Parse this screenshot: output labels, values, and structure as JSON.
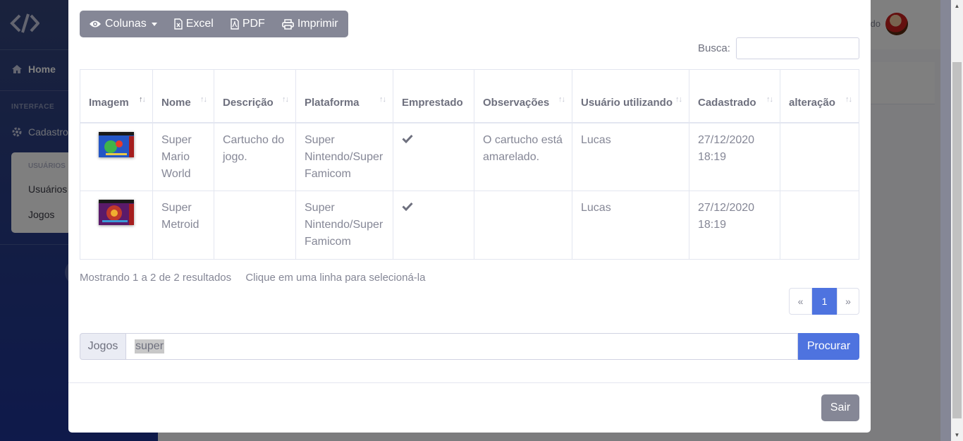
{
  "app": {
    "sidebar": {
      "home_label": "Home",
      "heading": "INTERFACE",
      "cadastros_label": "Cadastros",
      "submenu_heading": "USUÁRIOS",
      "submenu_items": [
        "Usuários",
        "Jogos"
      ]
    },
    "topbar": {
      "user_name": "Eduardo"
    }
  },
  "modal": {
    "toolbar": {
      "columns_label": "Colunas",
      "excel_label": "Excel",
      "pdf_label": "PDF",
      "print_label": "Imprimir"
    },
    "search": {
      "label": "Busca:",
      "value": ""
    },
    "table": {
      "headers": [
        "Imagem",
        "Nome",
        "Descrição",
        "Plataforma",
        "Emprestado",
        "Observações",
        "Usuário utilizando",
        "Cadastrado",
        "alteração"
      ],
      "rows": [
        {
          "image": "super-mario-world-cover",
          "nome": "Super Mario World",
          "descricao": "Cartucho do jogo.",
          "plataforma": "Super Nintendo/Super Famicom",
          "emprestado": true,
          "observacoes": "O cartucho está amarelado.",
          "usuario": "Lucas",
          "cadastrado": "27/12/2020 18:19",
          "alteracao": ""
        },
        {
          "image": "super-metroid-cover",
          "nome": "Super Metroid",
          "descricao": "",
          "plataforma": "Super Nintendo/Super Famicom",
          "emprestado": true,
          "observacoes": "",
          "usuario": "Lucas",
          "cadastrado": "27/12/2020 18:19",
          "alteracao": ""
        }
      ]
    },
    "info": {
      "showing": "Mostrando 1 a 2 de 2 resultados",
      "hint": "Clique em uma linha para selecioná-la"
    },
    "pagination": {
      "prev": "«",
      "current": "1",
      "next": "»"
    },
    "game_search": {
      "label": "Jogos",
      "value": "super",
      "button": "Procurar"
    },
    "footer": {
      "exit_label": "Sair"
    }
  },
  "colors": {
    "primary": "#4e73df",
    "secondary": "#858796",
    "sidebar": "#253a8a"
  }
}
